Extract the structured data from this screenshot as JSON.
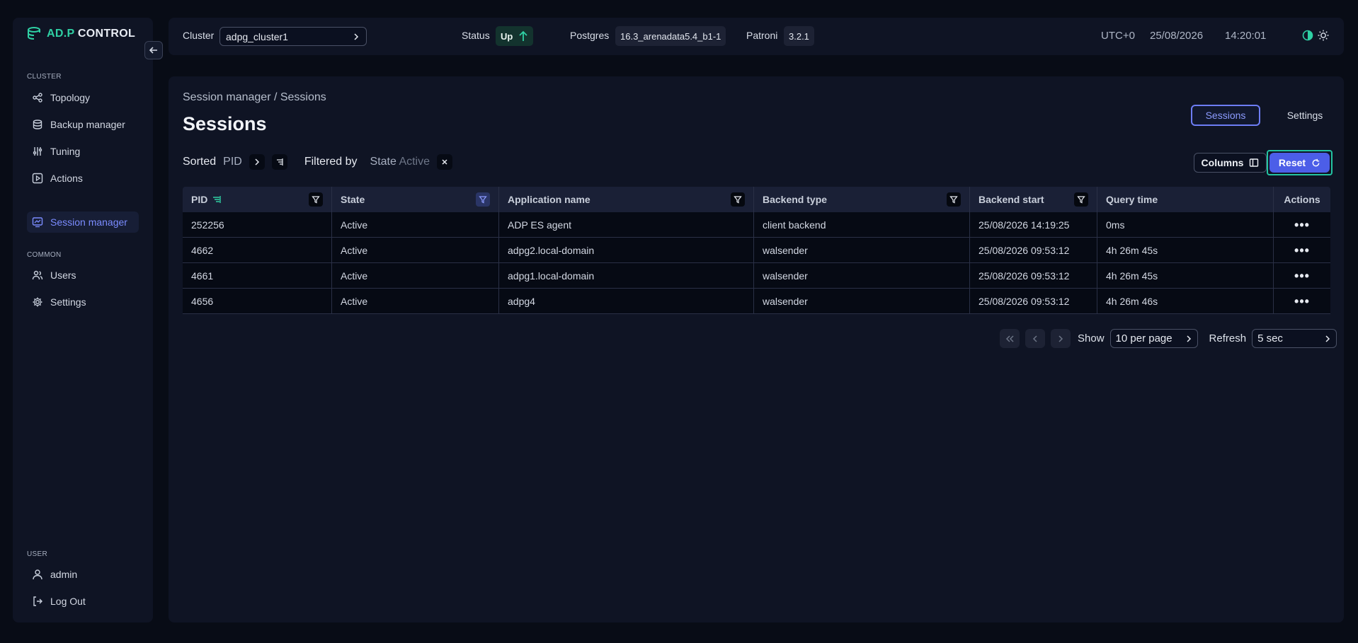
{
  "app": {
    "logo_text_left": "AD.P",
    "logo_text_right": "CONTROL"
  },
  "sidebar": {
    "cluster_section": "CLUSTER",
    "cluster_items": [
      {
        "label": "Topology",
        "icon": "topology-icon"
      },
      {
        "label": "Backup manager",
        "icon": "database-icon"
      },
      {
        "label": "Tuning",
        "icon": "sliders-icon"
      },
      {
        "label": "Actions",
        "icon": "play-icon"
      },
      {
        "label": "Session manager",
        "icon": "monitor-chart-icon",
        "active": true
      }
    ],
    "common_section": "COMMON",
    "common_items": [
      {
        "label": "Users",
        "icon": "users-icon"
      },
      {
        "label": "Settings",
        "icon": "gear-icon"
      }
    ],
    "user_section": "USER",
    "user_items": [
      {
        "label": "admin",
        "icon": "user-icon"
      },
      {
        "label": "Log Out",
        "icon": "logout-icon"
      }
    ]
  },
  "header": {
    "cluster_label": "Cluster",
    "cluster_value": "adpg_cluster1",
    "status_label": "Status",
    "status_value": "Up",
    "postgres_label": "Postgres",
    "postgres_value": "16.3_arenadata5.4_b1-1",
    "patroni_label": "Patroni",
    "patroni_value": "3.2.1",
    "timezone": "UTC+0",
    "date": "25/08/2026",
    "time": "14:20:01"
  },
  "main": {
    "breadcrumb": "Session manager / Sessions",
    "title": "Sessions",
    "tabs": [
      {
        "label": "Sessions",
        "active": true
      },
      {
        "label": "Settings",
        "active": false
      }
    ],
    "sorted_label": "Sorted",
    "sorted_by": "PID",
    "filtered_label": "Filtered by",
    "filter_field": "State",
    "filter_value": "Active",
    "columns_button": "Columns",
    "reset_button": "Reset"
  },
  "table": {
    "columns": [
      "PID",
      "State",
      "Application name",
      "Backend type",
      "Backend start",
      "Query time",
      "Actions"
    ],
    "rows": [
      [
        "252256",
        "Active",
        "ADP ES agent",
        "client backend",
        "25/08/2026 14:19:25",
        "0ms"
      ],
      [
        "4662",
        "Active",
        "adpg2.local-domain",
        "walsender",
        "25/08/2026 09:53:12",
        "4h 26m 45s"
      ],
      [
        "4661",
        "Active",
        "adpg1.local-domain",
        "walsender",
        "25/08/2026 09:53:12",
        "4h 26m 45s"
      ],
      [
        "4656",
        "Active",
        "adpg4",
        "walsender",
        "25/08/2026 09:53:12",
        "4h 26m 46s"
      ]
    ],
    "actions_glyph": "•••"
  },
  "pagination": {
    "show_label": "Show",
    "per_page": "10 per page",
    "refresh_label": "Refresh",
    "refresh_value": "5 sec"
  },
  "colors": {
    "accent": "#4c5ee8",
    "brand_green": "#2fd0a4",
    "active_nav": "#7b8cff"
  }
}
